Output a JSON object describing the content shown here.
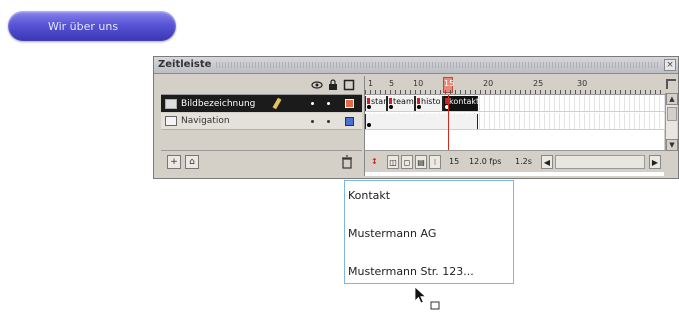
{
  "button": {
    "label": "Wir über uns"
  },
  "panel": {
    "title": "Zeitleiste",
    "close_glyph": "×",
    "ruler_ticks": [
      "1",
      "5",
      "10",
      "15",
      "20",
      "25",
      "30"
    ],
    "current_frame": 15,
    "layers": [
      {
        "name": "Bildbezeichnung",
        "selected": true,
        "color": "#e06a4a"
      },
      {
        "name": "Navigation",
        "selected": false,
        "color": "#4d6fd1"
      }
    ],
    "frame_spans": [
      {
        "label": "start",
        "dark": false
      },
      {
        "label": "team",
        "dark": false
      },
      {
        "label": "histo",
        "dark": false
      },
      {
        "label": "kontakt",
        "dark": true
      }
    ],
    "footer": {
      "frame_number": "15",
      "fps": "12.0 fps",
      "elapsed": "1.2s"
    }
  },
  "dropdown": {
    "items": [
      "Kontakt",
      "Mustermann AG",
      "Mustermann Str. 123..."
    ]
  }
}
